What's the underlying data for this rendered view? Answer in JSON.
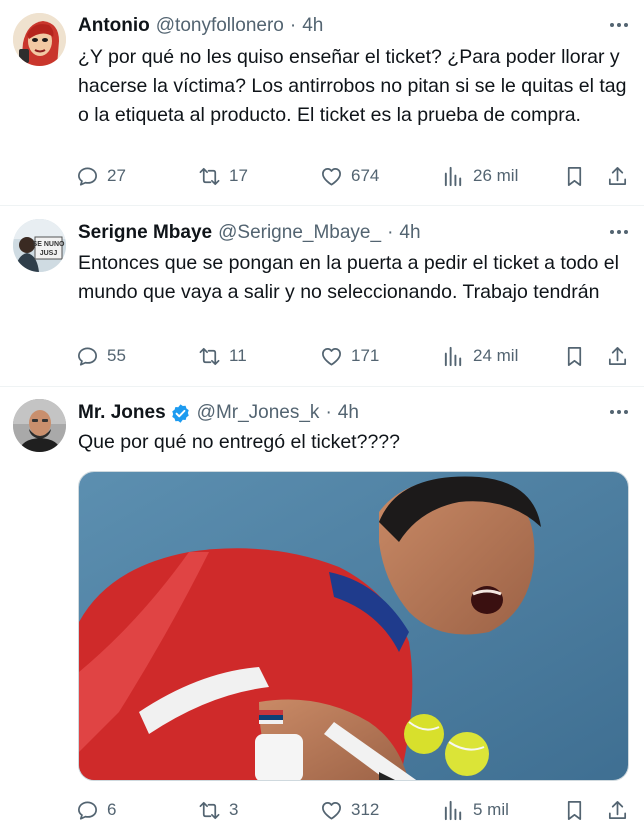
{
  "tweets": [
    {
      "name": "Antonio",
      "handle": "@tonyfollonero",
      "separator": "·",
      "time": "4h",
      "text": "¿Y por qué no les quiso enseñar el ticket? ¿Para poder llorar y hacerse la víctima? Los antirrobos no pitan si se le quitas el tag o la etiqueta al producto. El ticket es la prueba de compra.",
      "replies": "27",
      "retweets": "17",
      "likes": "674",
      "views": "26 mil"
    },
    {
      "name": "Serigne Mbaye",
      "handle": "@Serigne_Mbaye_",
      "separator": "·",
      "time": "4h",
      "avatar_text": "SE NUNO JUSJ",
      "text": "Entonces que se pongan en la puerta a pedir el ticket a todo el mundo que vaya a salir y no seleccionando. Trabajo tendrán",
      "replies": "55",
      "retweets": "11",
      "likes": "171",
      "views": "24 mil"
    },
    {
      "name": "Mr. Jones",
      "handle": "@Mr_Jones_k",
      "separator": "·",
      "time": "4h",
      "verified": true,
      "text": "Que por qué no entregó el ticket????",
      "replies": "6",
      "retweets": "3",
      "likes": "312",
      "views": "5 mil"
    }
  ],
  "icons": {
    "more": "more-icon",
    "reply": "reply-icon",
    "retweet": "retweet-icon",
    "like": "heart-icon",
    "views": "views-icon",
    "bookmark": "bookmark-icon",
    "share": "share-icon"
  },
  "colors": {
    "text": "#0f1419",
    "secondary": "#536471",
    "verified": "#1d9bf0",
    "divider": "#eff3f4"
  }
}
